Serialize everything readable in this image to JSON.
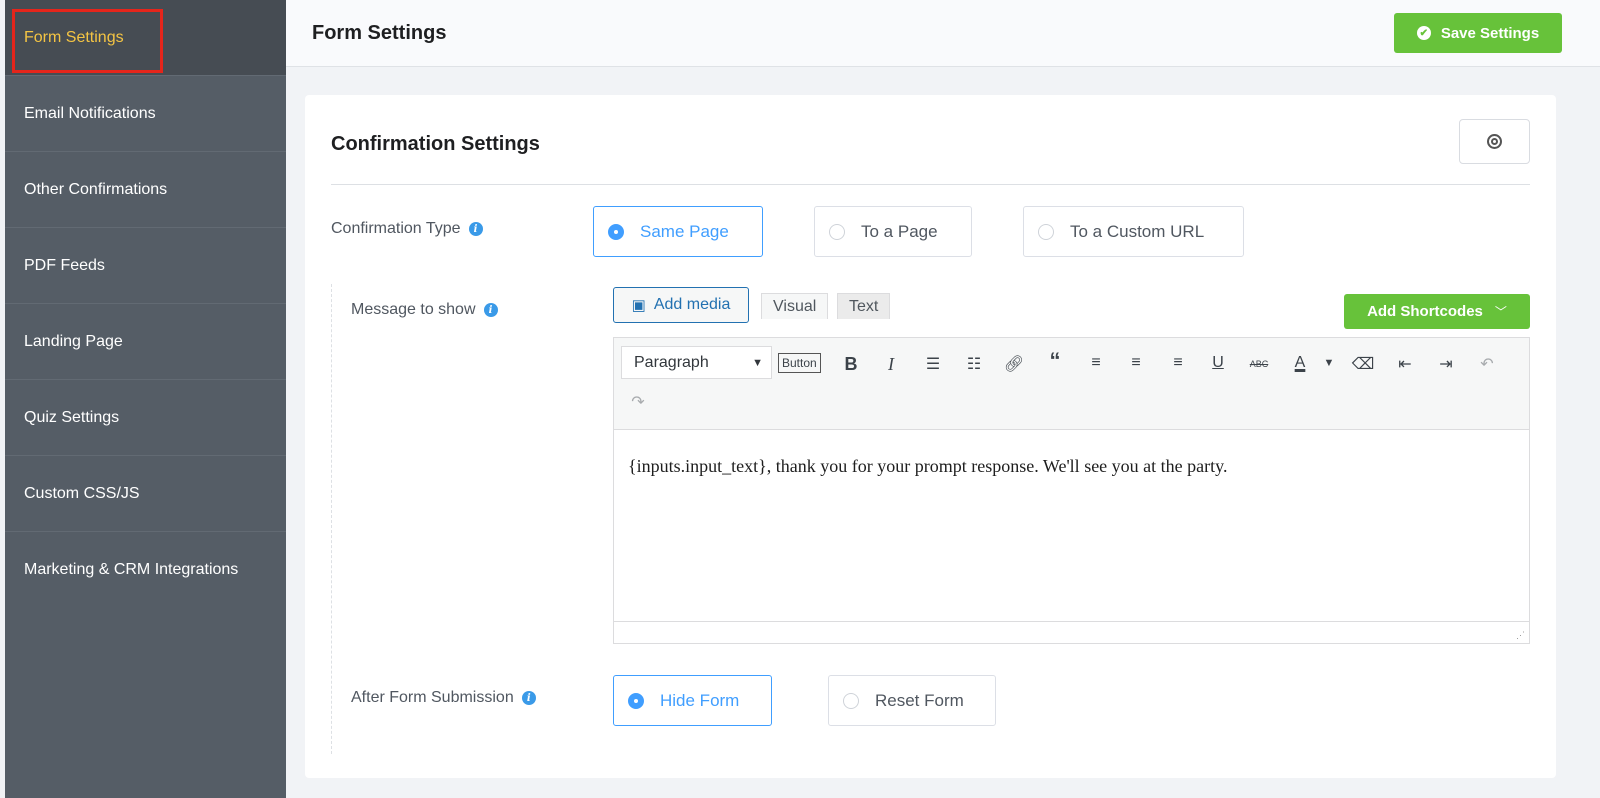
{
  "sidebar": {
    "items": [
      {
        "label": "Form Settings"
      },
      {
        "label": "Email Notifications"
      },
      {
        "label": "Other Confirmations"
      },
      {
        "label": "PDF Feeds"
      },
      {
        "label": "Landing Page"
      },
      {
        "label": "Quiz Settings"
      },
      {
        "label": "Custom CSS/JS"
      },
      {
        "label": "Marketing & CRM Integrations"
      }
    ]
  },
  "header": {
    "title": "Form Settings",
    "save_label": "Save Settings"
  },
  "card": {
    "title": "Confirmation Settings",
    "confirmation_type": {
      "label": "Confirmation Type",
      "options": [
        "Same Page",
        "To a Page",
        "To a Custom URL"
      ],
      "selected": "Same Page"
    },
    "message": {
      "label": "Message to show",
      "add_media": "Add media",
      "tab_visual": "Visual",
      "tab_text": "Text",
      "shortcodes": "Add Shortcodes",
      "format": "Paragraph",
      "button_label": "Button",
      "content": "{inputs.input_text}, thank you for your prompt response. We'll see you at the party."
    },
    "after_submission": {
      "label": "After Form Submission",
      "options": [
        "Hide Form",
        "Reset Form"
      ],
      "selected": "Hide Form"
    }
  },
  "colors": {
    "accent": "#409eff",
    "green": "#67c23a",
    "active": "#f4c443"
  }
}
